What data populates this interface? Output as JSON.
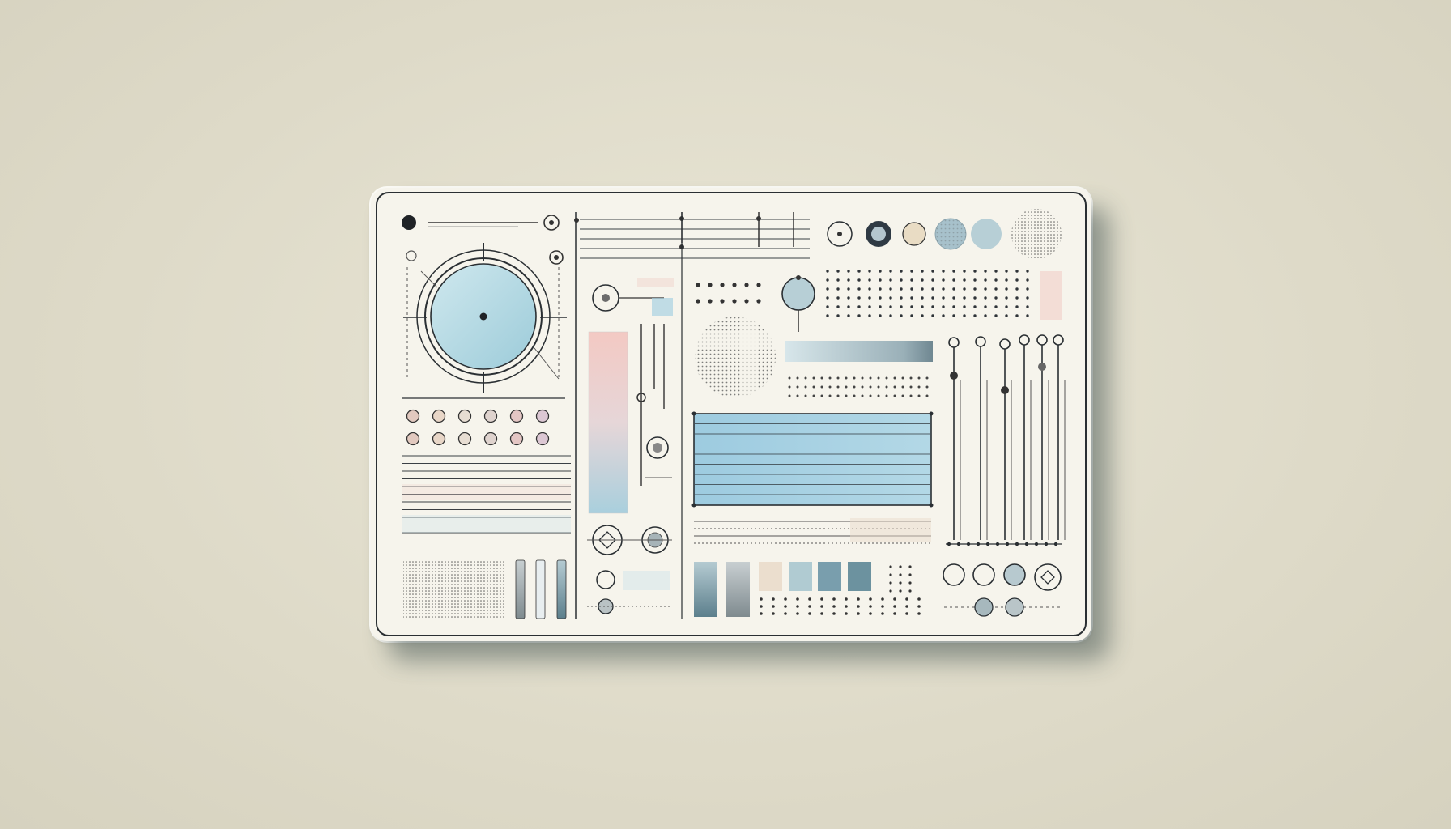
{
  "panel": {
    "colors": {
      "surface": "#f6f4ec",
      "ink": "#2a2f33",
      "dial_fill": "#b7dbe4",
      "gauge_blue": "#a9d2e2",
      "pink": "#f1cbc5",
      "steel": "#7f9aa4",
      "slate": "#5d7f8c",
      "sand": "#eadccb"
    },
    "icons": [
      "dial-icon",
      "knob-icon",
      "halftone-circle-icon",
      "slider-icon",
      "swatch-icon",
      "gauge-bar-icon"
    ],
    "dial": {
      "level": 0.5
    },
    "gauge": {
      "level": 1.0
    },
    "sliders": {
      "levels": [
        0.0,
        0.0,
        0.0,
        0.0,
        0.0
      ]
    },
    "swatches": [
      "#7f9aa4",
      "#9ca8ac",
      "#eadccb",
      "#a9c7cf",
      "#6c95a6",
      "#5d8797"
    ]
  }
}
